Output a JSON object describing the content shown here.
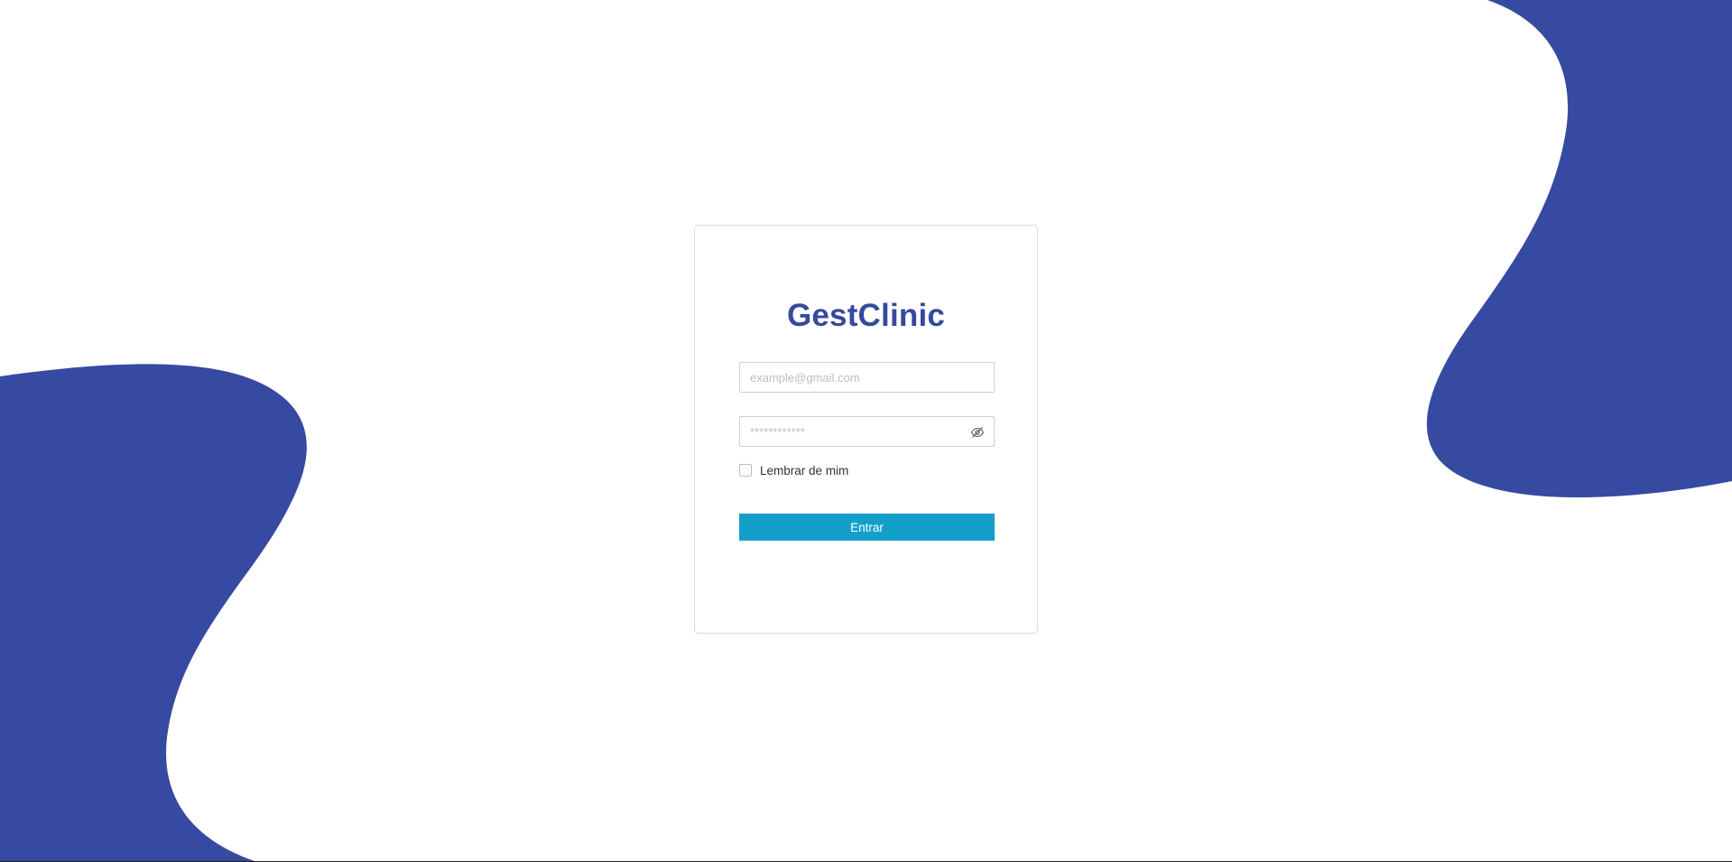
{
  "colors": {
    "background": "#ffffff",
    "blob": "#354aa0",
    "brand": "#3549a0",
    "button": "#149fcb",
    "button_text": "#ffffff"
  },
  "login": {
    "title": "GestClinic",
    "email": {
      "placeholder": "example@gmail.com",
      "value": ""
    },
    "password": {
      "placeholder": "************",
      "value": "",
      "toggle_icon": "eye-slash-icon"
    },
    "remember": {
      "label": "Lembrar de mim",
      "checked": false
    },
    "submit_label": "Entrar"
  }
}
